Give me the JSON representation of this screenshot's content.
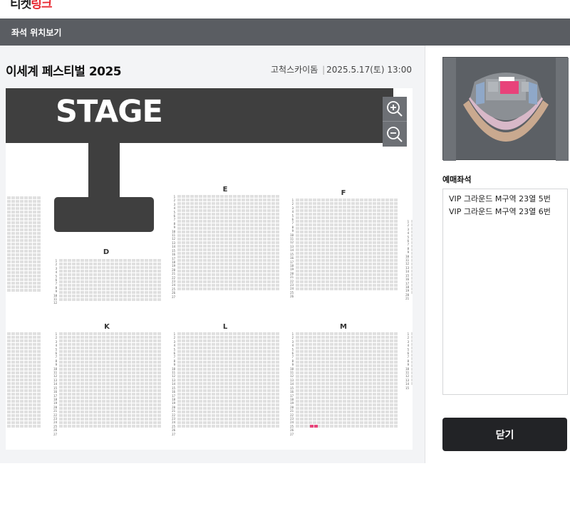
{
  "header": {
    "logo_part1": "티켓",
    "logo_part2": "링크"
  },
  "titlebar": {
    "title": "좌석 위치보기"
  },
  "event": {
    "title": "이세계 페스티벌 2025",
    "venue": "고척스카이돔",
    "separator": "|",
    "datetime": "2025.5.17(토) 13:00"
  },
  "seatmap": {
    "stage_label": "STAGE",
    "sections_top": [
      "D",
      "E",
      "F"
    ],
    "sections_bottom": [
      "K",
      "L",
      "M"
    ]
  },
  "booked": {
    "title": "예매좌석",
    "items": [
      "VIP 그라운드 M구역 23열 5번",
      "VIP 그라운드 M구역 23열 6번"
    ]
  },
  "actions": {
    "close_label": "닫기"
  },
  "colors": {
    "selected": "#e8437a",
    "stage": "#3f3f3f",
    "seat": "#e0e0e0"
  }
}
